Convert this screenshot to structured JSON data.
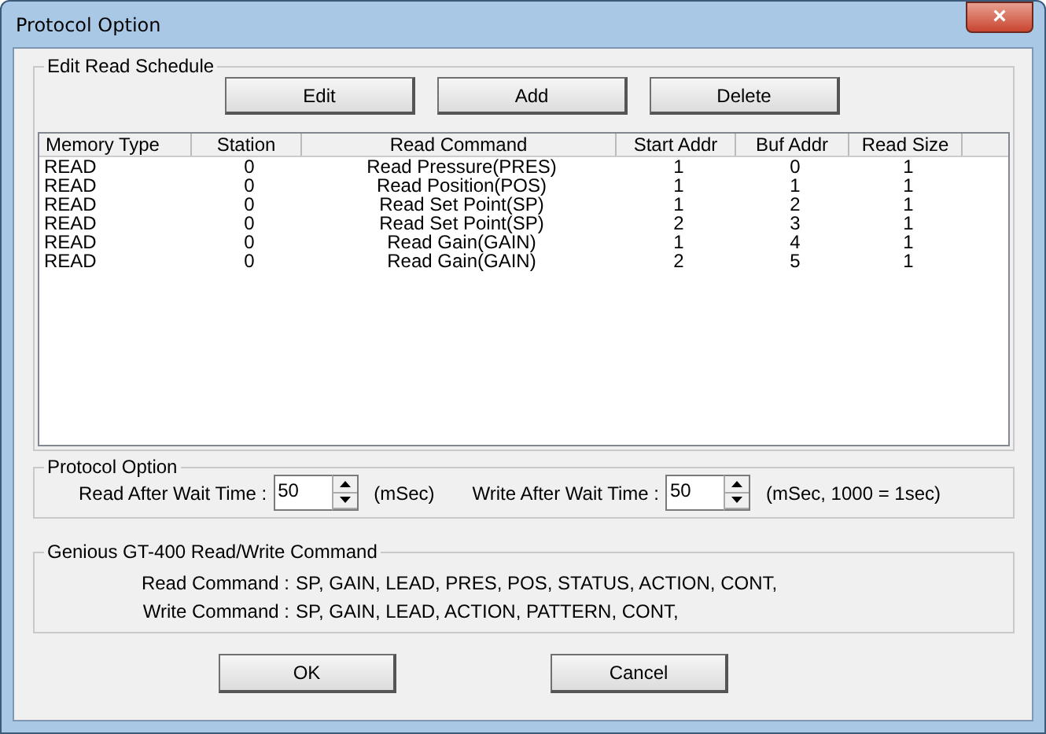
{
  "window": {
    "title": "Protocol Option",
    "close": "×"
  },
  "schedule": {
    "title": "Edit Read Schedule",
    "buttons": [
      "Edit",
      "Add",
      "Delete"
    ],
    "columns": [
      "Memory Type",
      "Station",
      "Read Command",
      "Start Addr",
      "Buf Addr",
      "Read Size"
    ],
    "rows": [
      [
        "READ",
        "0",
        "Read Pressure(PRES)",
        "1",
        "0",
        "1"
      ],
      [
        "READ",
        "0",
        "Read Position(POS)",
        "1",
        "1",
        "1"
      ],
      [
        "READ",
        "0",
        "Read Set Point(SP)",
        "1",
        "2",
        "1"
      ],
      [
        "READ",
        "0",
        "Read Set Point(SP)",
        "2",
        "3",
        "1"
      ],
      [
        "READ",
        "0",
        "Read Gain(GAIN)",
        "1",
        "4",
        "1"
      ],
      [
        "READ",
        "0",
        "Read Gain(GAIN)",
        "2",
        "5",
        "1"
      ]
    ]
  },
  "protocol": {
    "title": "Protocol Option",
    "fields": [
      {
        "label": "Read After Wait Time :",
        "value": "50",
        "unit": "(mSec)"
      },
      {
        "label": "Write After Wait Time :",
        "value": "50",
        "unit": "(mSec, 1000 = 1sec)"
      }
    ]
  },
  "commands": {
    "title": "Genious GT-400 Read/Write Command",
    "lines": [
      {
        "label": "Read Command :",
        "value": "SP, GAIN, LEAD, PRES, POS, STATUS, ACTION, CONT,"
      },
      {
        "label": "Write Command :",
        "value": "SP, GAIN, LEAD, ACTION, PATTERN, CONT,"
      }
    ]
  },
  "buttons": [
    "OK",
    "Cancel"
  ]
}
